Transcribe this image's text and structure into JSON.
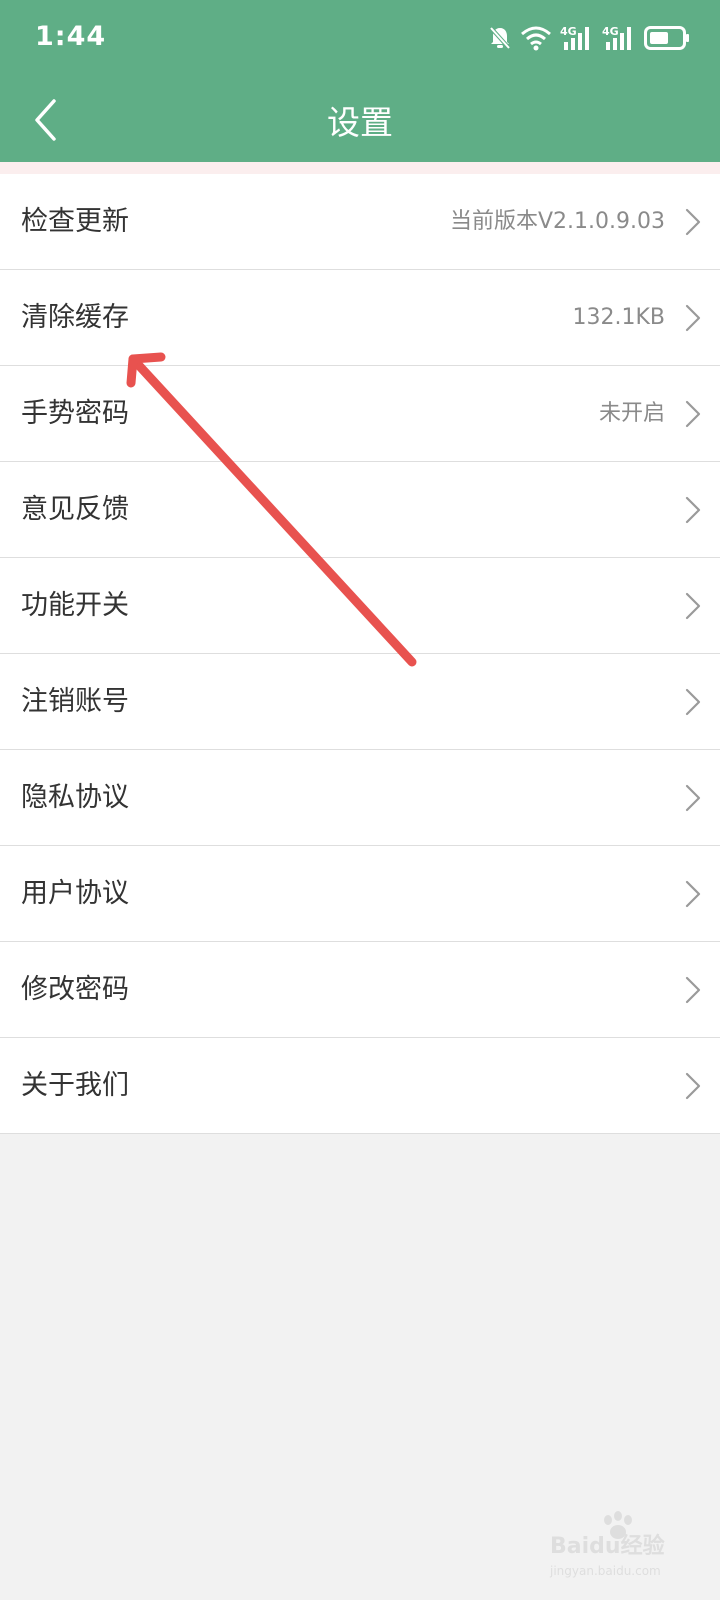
{
  "status_bar": {
    "time": "1:44",
    "network_1": "4G",
    "network_2": "4G",
    "icons": [
      "bell-off-icon",
      "wifi-icon",
      "signal-icon",
      "signal-icon",
      "battery-icon"
    ]
  },
  "header": {
    "title": "设置",
    "back_icon": "chevron-left-icon",
    "background_color": "#5fae86"
  },
  "settings": {
    "items": [
      {
        "label": "检查更新",
        "value": "当前版本V2.1.0.9.03"
      },
      {
        "label": "清除缓存",
        "value": "132.1KB"
      },
      {
        "label": "手势密码",
        "value": "未开启"
      },
      {
        "label": "意见反馈",
        "value": ""
      },
      {
        "label": "功能开关",
        "value": ""
      },
      {
        "label": "注销账号",
        "value": ""
      },
      {
        "label": "隐私协议",
        "value": ""
      },
      {
        "label": "用户协议",
        "value": ""
      },
      {
        "label": "修改密码",
        "value": ""
      },
      {
        "label": "关于我们",
        "value": ""
      }
    ]
  },
  "annotation": {
    "color": "#e8524f",
    "target": "清除缓存"
  },
  "watermark": {
    "brand": "Baidu经验",
    "url": "jingyan.baidu.com"
  }
}
